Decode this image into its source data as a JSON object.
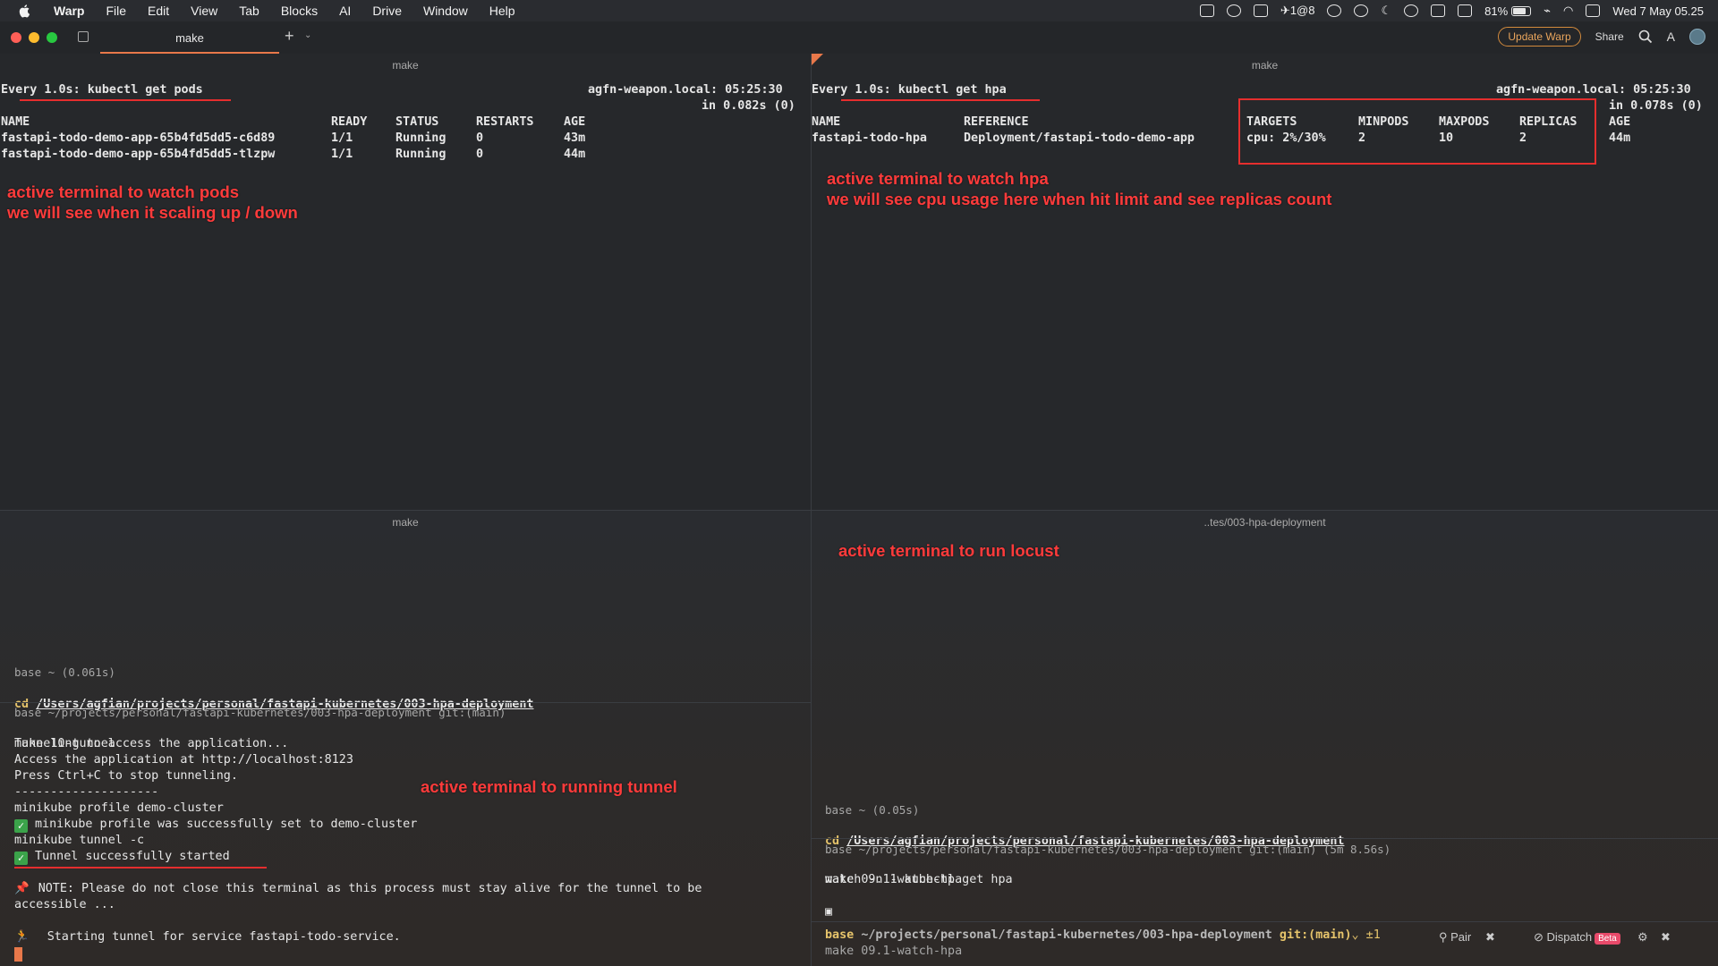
{
  "menubar": {
    "items": [
      "Warp",
      "File",
      "Edit",
      "View",
      "Tab",
      "Blocks",
      "AI",
      "Drive",
      "Window",
      "Help"
    ],
    "status_text": "1@8",
    "battery": "81%",
    "battery_level": 0.81,
    "datetime": "Wed 7 May  05.25"
  },
  "tabbar": {
    "tab_title": "make",
    "update_label": "Update Warp",
    "share_label": "Share"
  },
  "pane_tl": {
    "title": "make",
    "header_left": "Every 1.0s: kubectl get pods",
    "header_right": "agfn-weapon.local: 05:25:30",
    "header_right2": "in 0.082s (0)",
    "columns": [
      "NAME",
      "READY",
      "STATUS",
      "RESTARTS",
      "AGE"
    ],
    "rows": [
      [
        "fastapi-todo-demo-app-65b4fd5dd5-c6d89",
        "1/1",
        "Running",
        "0",
        "43m"
      ],
      [
        "fastapi-todo-demo-app-65b4fd5dd5-tlzpw",
        "1/1",
        "Running",
        "0",
        "44m"
      ]
    ],
    "annotation_1": "active terminal to watch pods",
    "annotation_2": "we will see when it scaling up / down"
  },
  "pane_tr": {
    "title": "make",
    "header_left": "Every 1.0s: kubectl get hpa",
    "header_right": "agfn-weapon.local: 05:25:30",
    "header_right2": "in 0.078s (0)",
    "columns": [
      "NAME",
      "REFERENCE",
      "TARGETS",
      "MINPODS",
      "MAXPODS",
      "REPLICAS",
      "AGE"
    ],
    "row": [
      "fastapi-todo-hpa",
      "Deployment/fastapi-todo-demo-app",
      "cpu: 2%/30%",
      "2",
      "10",
      "2",
      "44m"
    ],
    "annotation_1": "active terminal to watch hpa",
    "annotation_2": "we will see cpu usage here when hit limit and see replicas count"
  },
  "pane_bl": {
    "title": "make",
    "block1_prompt": "base ~ (0.061s)",
    "block1_cmd_prefix": "cd",
    "block1_cmd_path": "/Users/agfian/projects/personal/fastapi-kubernetes/003-hpa-deployment",
    "block2_prompt": "base ~/projects/personal/fastapi-kubernetes/003-hpa-deployment git:(main)",
    "block2_cmd_prefix": "make",
    "block2_cmd_arg": "10-tunnel",
    "lines": [
      "Tunneling to access the application...",
      "Access the application at http://localhost:8123",
      "Press Ctrl+C to stop tunneling.",
      "--------------------",
      "minikube profile demo-cluster"
    ],
    "check_line_1": "minikube profile was successfully set to demo-cluster",
    "line_tunnel_cmd": "minikube tunnel -c",
    "check_line_2": "Tunnel successfully started",
    "note_line_1": "NOTE: Please do not close this terminal as this process must stay alive for the tunnel to be",
    "note_line_2": "accessible ...",
    "starting_line": "Starting tunnel for service fastapi-todo-service.",
    "annotation": "active terminal to running tunnel"
  },
  "pane_br": {
    "title": "..tes/003-hpa-deployment",
    "annotation": "active terminal to run locust",
    "block1_prompt": "base ~ (0.05s)",
    "block1_cmd_prefix": "cd",
    "block1_cmd_path": "/Users/agfian/projects/personal/fastapi-kubernetes/003-hpa-deployment",
    "block2_prompt": "base ~/projects/personal/fastapi-kubernetes/003-hpa-deployment git:(main) (5m 8.56s)",
    "block2_cmd_prefix": "make",
    "block2_cmd_arg": "09.1-watch-hpa",
    "block2_line": "watch -n 1 kubectl get hpa",
    "cursor_glyph": "▣",
    "status_prefix": "base",
    "status_path": "~/projects/personal/fastapi-kubernetes/003-hpa-deployment",
    "status_git": "git:(main)",
    "status_changes": "±1",
    "status_input": "make 09.1-watch-hpa",
    "pair_label": "Pair",
    "dispatch_label": "Dispatch",
    "beta_label": "Beta"
  },
  "colors": {
    "annotation_red": "#ff3b3b",
    "accent_orange": "#e8784a"
  }
}
